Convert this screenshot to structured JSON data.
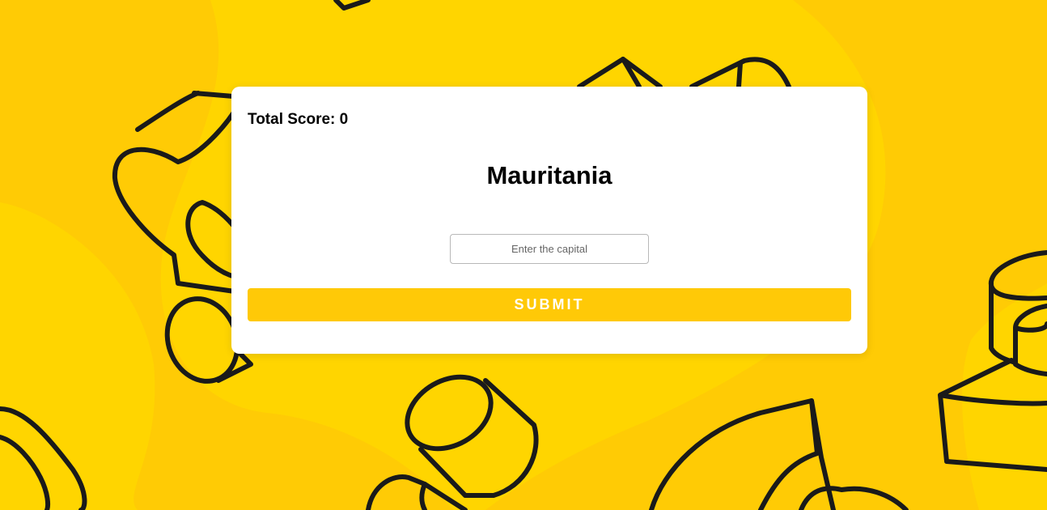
{
  "game": {
    "score_label": "Total Score: 0",
    "country": "Mauritania",
    "input_placeholder": "Enter the capital",
    "input_value": "",
    "submit_label": "SUBMIT"
  },
  "colors": {
    "background": "#ffcb05",
    "background_shape": "#ffd500",
    "accent": "#ffc907",
    "card": "#ffffff",
    "outline": "#1a1a1a"
  }
}
